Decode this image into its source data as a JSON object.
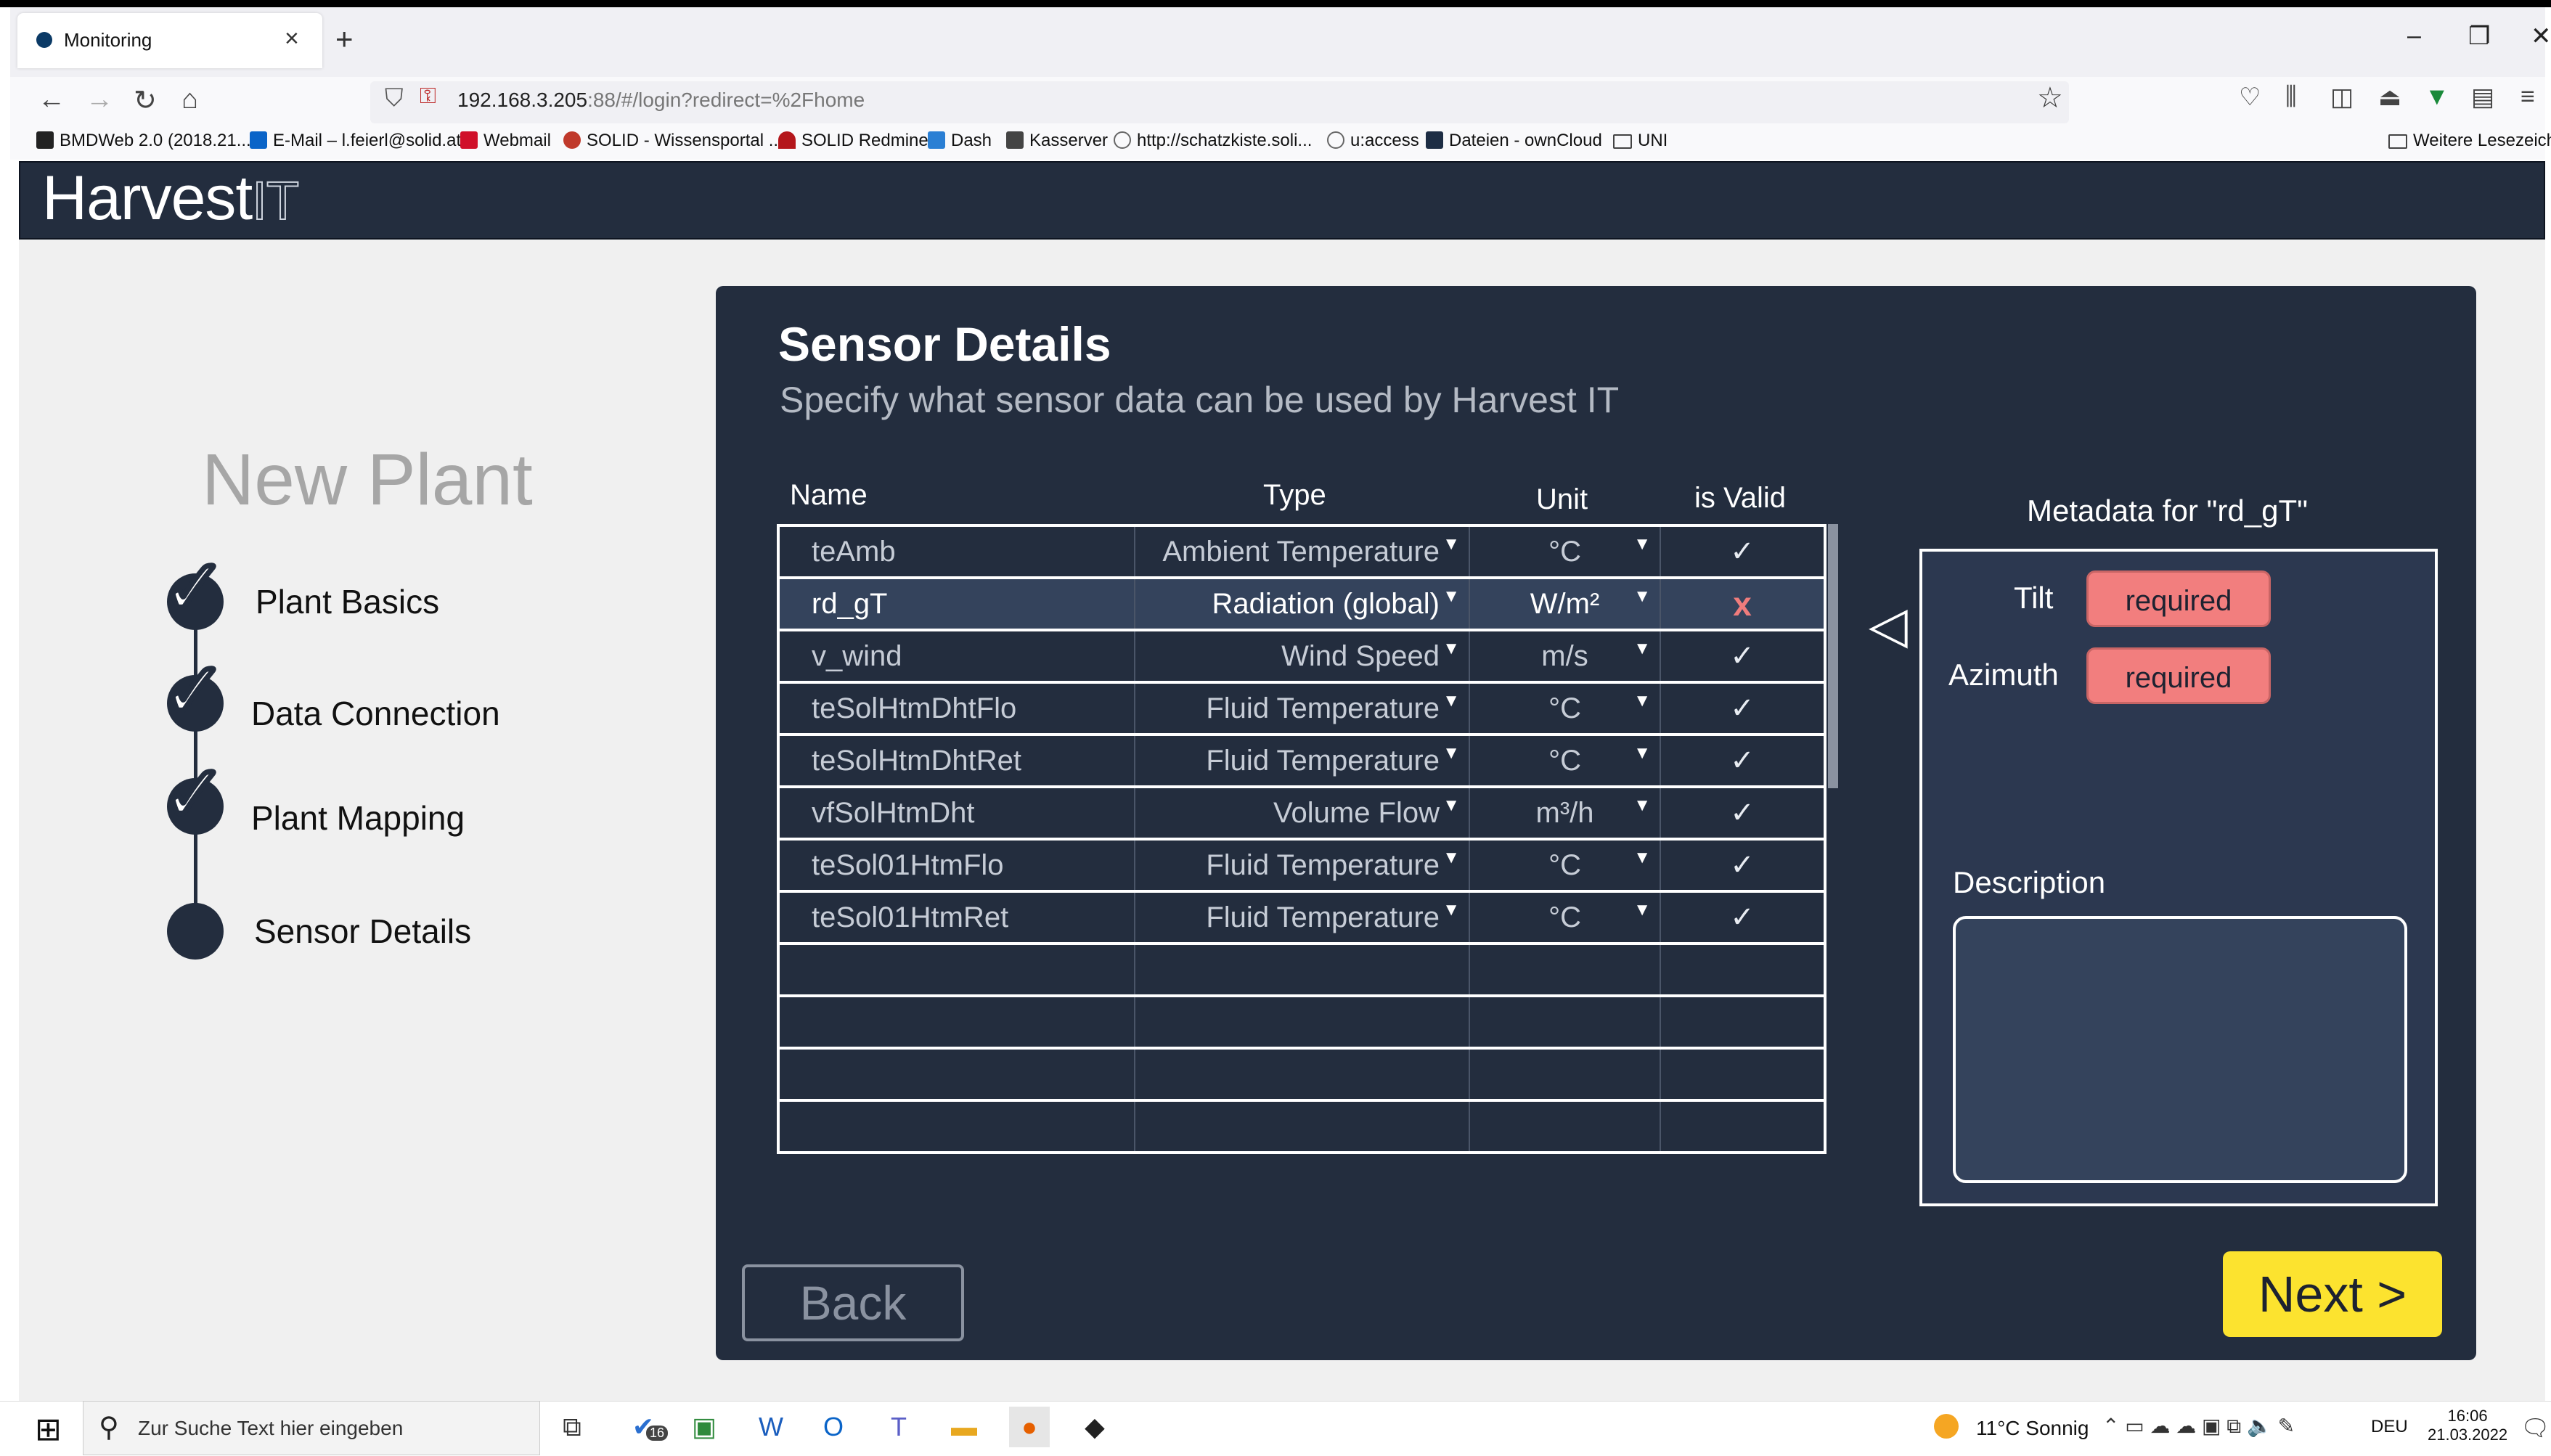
{
  "browser": {
    "tab_title": "Monitoring",
    "tab_close": "×",
    "new_tab": "+",
    "url_main": "192.168.3.205",
    "url_rest": ":88/#/login?redirect=%2Fhome",
    "minimize": "–",
    "restore": "❐",
    "close": "✕",
    "bookmarks": [
      {
        "label": "BMDWeb 2.0 (2018.21....",
        "icon": "bmd-icon",
        "color": "#222222"
      },
      {
        "label": "E-Mail – l.feierl@solid.at",
        "icon": "outlook-icon",
        "color": "#0a64c8"
      },
      {
        "label": "Webmail",
        "icon": "webmail-icon",
        "color": "#d0102a"
      },
      {
        "label": "SOLID - Wissensportal ...",
        "icon": "confluence-icon",
        "color": "#c0392b"
      },
      {
        "label": "SOLID Redmine",
        "icon": "redmine-icon",
        "color": "#b4161b"
      },
      {
        "label": "Dash",
        "icon": "dash-icon",
        "color": "#2a7fd4"
      },
      {
        "label": "Kasserver",
        "icon": "kas-icon",
        "color": "#444444"
      },
      {
        "label": "http://schatzkiste.soli...",
        "icon": "globe-icon",
        "color": "#666666"
      },
      {
        "label": "u:access",
        "icon": "globe-icon",
        "color": "#666666"
      },
      {
        "label": "Dateien - ownCloud",
        "icon": "owncloud-icon",
        "color": "#1d2d44"
      },
      {
        "label": "UNI",
        "icon": "folder-icon",
        "color": "#444444"
      }
    ],
    "other_bookmarks": "Weitere Lesezeichen"
  },
  "app": {
    "logo_main": "Harvest",
    "logo_suffix": "IT",
    "brand_color": "#232d3e",
    "accent_color": "#fce32f",
    "error_color": "#f27e7e"
  },
  "wizard": {
    "title": "New Plant",
    "steps": [
      {
        "label": "Plant Basics",
        "done": true
      },
      {
        "label": "Data Connection",
        "done": true
      },
      {
        "label": "Plant Mapping",
        "done": true
      },
      {
        "label": "Sensor Details",
        "done": false
      }
    ]
  },
  "panel": {
    "title": "Sensor Details",
    "subtitle": "Specify what sensor data can be used by Harvest IT",
    "columns": {
      "name": "Name",
      "type": "Type",
      "unit": "Unit",
      "valid": "is Valid"
    },
    "rows": [
      {
        "name": "teAmb",
        "type": "Ambient Temperature",
        "unit": "°C",
        "valid": "✓"
      },
      {
        "name": "rd_gT",
        "type": "Radiation (global)",
        "unit": "W/m²",
        "valid": "x"
      },
      {
        "name": "v_wind",
        "type": "Wind Speed",
        "unit": "m/s",
        "valid": "✓"
      },
      {
        "name": "teSolHtmDhtFlo",
        "type": "Fluid Temperature",
        "unit": "°C",
        "valid": "✓"
      },
      {
        "name": "teSolHtmDhtRet",
        "type": "Fluid Temperature",
        "unit": "°C",
        "valid": "✓"
      },
      {
        "name": "vfSolHtmDht",
        "type": "Volume Flow",
        "unit": "m³/h",
        "valid": "✓"
      },
      {
        "name": "teSol01HtmFlo",
        "type": "Fluid Temperature",
        "unit": "°C",
        "valid": "✓"
      },
      {
        "name": "teSol01HtmRet",
        "type": "Fluid Temperature",
        "unit": "°C",
        "valid": "✓"
      }
    ],
    "empty_rows": 4,
    "caret": "▼",
    "expand_arrow": "◁",
    "metadata": {
      "title": "Metadata for \"rd_gT\"",
      "tilt_label": "Tilt",
      "tilt_value": "required",
      "azimuth_label": "Azimuth",
      "azimuth_value": "required",
      "description_label": "Description",
      "description_value": ""
    },
    "back_label": "Back",
    "next_label": "Next >"
  },
  "taskbar": {
    "search_placeholder": "Zur Suche Text hier eingeben",
    "badge_count": "16",
    "weather": "11°C  Sonnig",
    "language": "DEU",
    "time": "16:06",
    "date": "21.03.2022"
  }
}
